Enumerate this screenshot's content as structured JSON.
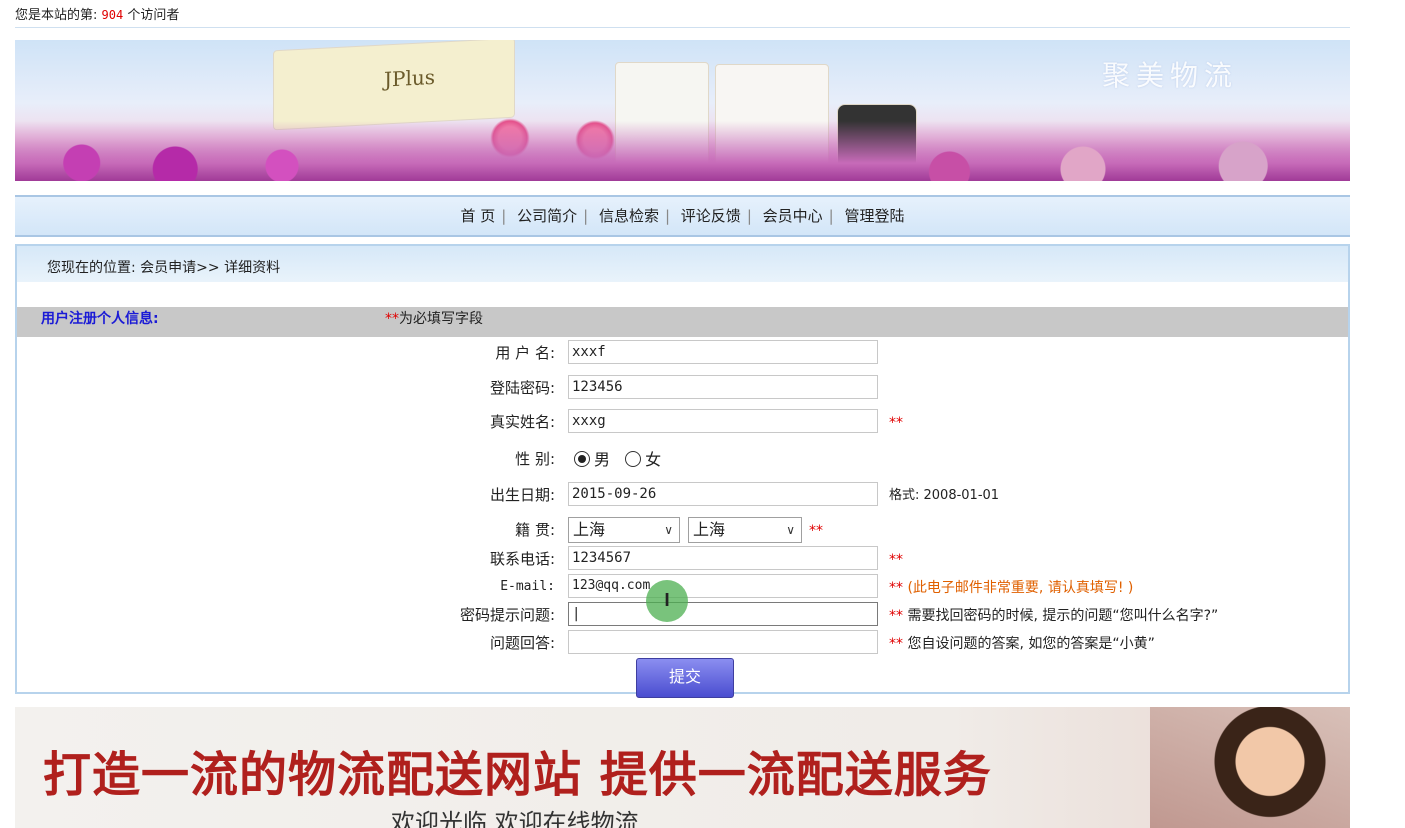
{
  "visitor": {
    "prefix": "您是本站的第:",
    "count": "904",
    "suffix": "个访问者"
  },
  "banner": {
    "title": "聚美物流",
    "product_brand": "JPlus"
  },
  "nav": {
    "items": [
      "首 页",
      "公司简介",
      "信息检索",
      "评论反馈",
      "会员中心",
      "管理登陆"
    ],
    "separator": "|"
  },
  "breadcrumb": {
    "prefix": "您现在的位置:",
    "path": "会员申请>> 详细资料"
  },
  "form": {
    "section_title": "用户注册个人信息:",
    "required_marker": "**",
    "required_hint": "为必填写字段",
    "fields": [
      {
        "label": "用 户 名:",
        "value": "xxxf"
      },
      {
        "label": "登陆密码:",
        "value": "123456"
      },
      {
        "label": "真实姓名:",
        "value": "xxxg",
        "note": "**"
      },
      {
        "label": "性    别:"
      },
      {
        "label": "出生日期:",
        "value": "2015-09-26",
        "note": "格式: 2008-01-01"
      },
      {
        "label": "籍    贯:",
        "note": "**"
      },
      {
        "label": "联系电话:",
        "value": "1234567",
        "note": "**"
      },
      {
        "label": "E-mail:",
        "value": "123@qq.com",
        "note_marker": "**",
        "note": "(此电子邮件非常重要, 请认真填写! )"
      },
      {
        "label": "密码提示问题:",
        "value": "|",
        "note_marker": "**",
        "note": "需要找回密码的时候, 提示的问题“您叫什么名字?”"
      },
      {
        "label": "问题回答:",
        "value": "",
        "note_marker": "**",
        "note": "您自设问题的答案, 如您的答案是“小黄”"
      }
    ],
    "gender": {
      "male": "男",
      "female": "女",
      "selected": "男"
    },
    "province": {
      "selected": "上海"
    },
    "city": {
      "selected": "上海"
    },
    "submit_label": "提交"
  },
  "footer": {
    "slogan": "打造一流的物流配送网站 提供一流配送服务",
    "subtitle": "欢迎光临 欢迎在线物流"
  },
  "colors": {
    "required": "#e00000",
    "section_title": "#1a1ad6",
    "email_note": "#e06000"
  }
}
